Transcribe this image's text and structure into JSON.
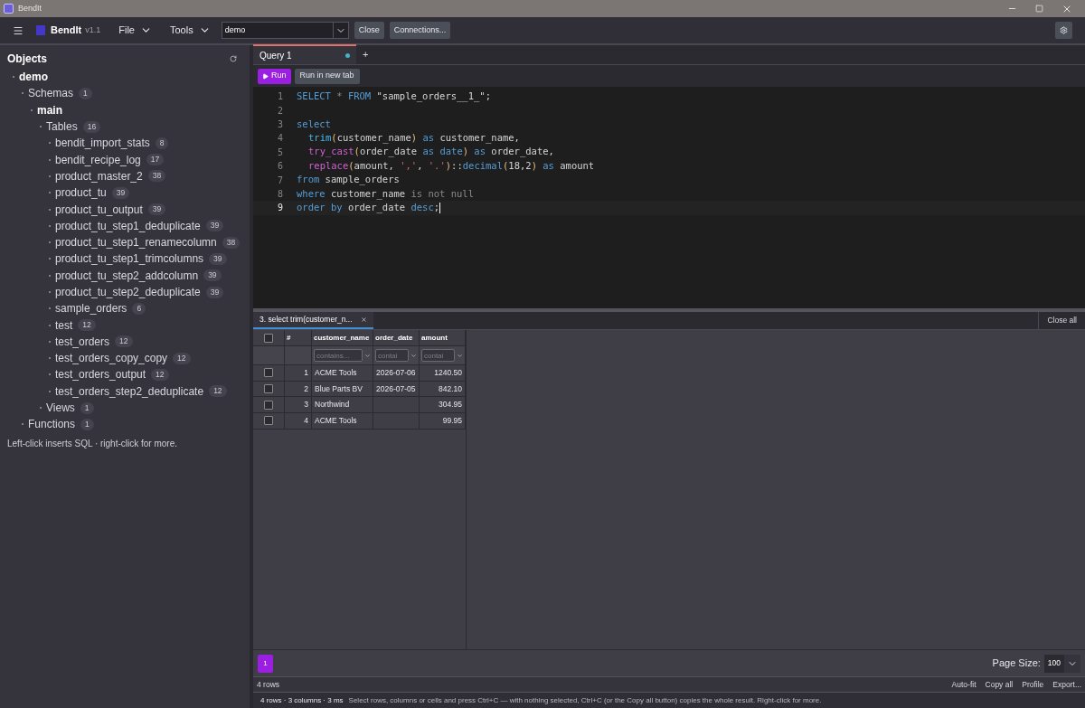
{
  "window": {
    "title": "BendIt"
  },
  "toolbar": {
    "app_name": "BendIt",
    "version": "v1.1",
    "menus": [
      {
        "label": "File"
      },
      {
        "label": "Tools"
      }
    ],
    "connection": {
      "value": "demo"
    },
    "buttons": [
      "Close",
      "Connections..."
    ]
  },
  "sidebar": {
    "title": "Objects",
    "tree": [
      {
        "label": "demo",
        "bold": true,
        "children": [
          {
            "label": "Schemas",
            "count": "1",
            "bold": false,
            "children": [
              {
                "label": "main",
                "bold": true,
                "children": [
                  {
                    "label": "Tables",
                    "count": "16",
                    "bold": false,
                    "children": [
                      {
                        "label": "bendit_import_stats",
                        "count": "8",
                        "bold": false
                      },
                      {
                        "label": "bendit_recipe_log",
                        "count": "17",
                        "bold": false
                      },
                      {
                        "label": "product_master_2",
                        "count": "38",
                        "bold": false
                      },
                      {
                        "label": "product_tu",
                        "count": "39",
                        "bold": false
                      },
                      {
                        "label": "product_tu_output",
                        "count": "39",
                        "bold": false
                      },
                      {
                        "label": "product_tu_step1_deduplicate",
                        "count": "39",
                        "bold": false
                      },
                      {
                        "label": "product_tu_step1_renamecolumn",
                        "count": "38",
                        "bold": false
                      },
                      {
                        "label": "product_tu_step1_trimcolumns",
                        "count": "39",
                        "bold": false
                      },
                      {
                        "label": "product_tu_step2_addcolumn",
                        "count": "39",
                        "bold": false
                      },
                      {
                        "label": "product_tu_step2_deduplicate",
                        "count": "39",
                        "bold": false
                      },
                      {
                        "label": "sample_orders",
                        "count": "6",
                        "bold": false
                      },
                      {
                        "label": "test",
                        "count": "12",
                        "bold": false
                      },
                      {
                        "label": "test_orders",
                        "count": "12",
                        "bold": false
                      },
                      {
                        "label": "test_orders_copy_copy",
                        "count": "12",
                        "bold": false
                      },
                      {
                        "label": "test_orders_output",
                        "count": "12",
                        "bold": false
                      },
                      {
                        "label": "test_orders_step2_deduplicate",
                        "count": "12",
                        "bold": false
                      }
                    ]
                  },
                  {
                    "label": "Views",
                    "count": "1",
                    "bold": false
                  }
                ]
              }
            ]
          },
          {
            "label": "Functions",
            "count": "1",
            "bold": false
          }
        ]
      }
    ],
    "hint": "Left-click inserts SQL · right-click for more."
  },
  "editor": {
    "tabs": [
      {
        "label": "Query 1",
        "selected": true,
        "modified": true
      }
    ],
    "new_tab": "+",
    "run": "Run",
    "run_new": "Run in new tab",
    "lines": [
      {
        "number": "1",
        "current": false,
        "tokens": [
          {
            "kind": "keyword",
            "text": "SELECT"
          },
          {
            "kind": "op",
            "text": " * "
          },
          {
            "kind": "keyword",
            "text": "FROM"
          },
          {
            "kind": "plain",
            "text": " \"sample_orders__1_\";"
          }
        ]
      },
      {
        "number": "2",
        "current": false
      },
      {
        "number": "3",
        "current": false,
        "tokens": [
          {
            "kind": "keyword",
            "text": "select"
          }
        ]
      },
      {
        "number": "4",
        "current": false,
        "indent": true,
        "tokens": [
          {
            "kind": "function",
            "text": "trim"
          },
          {
            "kind": "paren",
            "text": "("
          },
          {
            "kind": "plain",
            "text": "customer_name"
          },
          {
            "kind": "paren",
            "text": ")"
          },
          {
            "kind": "keyword",
            "text": " as"
          },
          {
            "kind": "plain",
            "text": " customer_name,"
          }
        ]
      },
      {
        "number": "5",
        "current": false,
        "indent": true,
        "tokens": [
          {
            "kind": "builtin",
            "text": "try_cast"
          },
          {
            "kind": "paren",
            "text": "("
          },
          {
            "kind": "plain",
            "text": "order_date "
          },
          {
            "kind": "keyword",
            "text": "as date"
          },
          {
            "kind": "paren",
            "text": ")"
          },
          {
            "kind": "keyword",
            "text": " as"
          },
          {
            "kind": "plain",
            "text": " order_date,"
          }
        ]
      },
      {
        "number": "6",
        "current": false,
        "indent": true,
        "tokens": [
          {
            "kind": "builtin",
            "text": "replace"
          },
          {
            "kind": "paren",
            "text": "("
          },
          {
            "kind": "plain",
            "text": "amount, "
          },
          {
            "kind": "string",
            "text": "','"
          },
          {
            "kind": "plain",
            "text": ", "
          },
          {
            "kind": "string",
            "text": "'.'"
          },
          {
            "kind": "paren",
            "text": ")"
          },
          {
            "kind": "plain",
            "text": "::"
          },
          {
            "kind": "keyword",
            "text": "decimal"
          },
          {
            "kind": "paren",
            "text": "("
          },
          {
            "kind": "plain",
            "text": "18,2"
          },
          {
            "kind": "paren",
            "text": ")"
          },
          {
            "kind": "keyword",
            "text": " as"
          },
          {
            "kind": "plain",
            "text": " amount"
          }
        ]
      },
      {
        "number": "7",
        "current": false,
        "tokens": [
          {
            "kind": "keyword",
            "text": "from"
          },
          {
            "kind": "plain",
            "text": " sample_orders"
          }
        ]
      },
      {
        "number": "8",
        "current": false,
        "tokens": [
          {
            "kind": "keyword",
            "text": "where"
          },
          {
            "kind": "plain",
            "text": " customer_name "
          },
          {
            "kind": "op",
            "text": "is not null"
          }
        ]
      },
      {
        "number": "9",
        "current": true,
        "tokens": [
          {
            "kind": "keyword",
            "text": "order by"
          },
          {
            "kind": "plain",
            "text": " order_date "
          },
          {
            "kind": "keyword",
            "text": "desc"
          },
          {
            "kind": "plain",
            "text": ";"
          }
        ]
      }
    ]
  },
  "results": {
    "select_all_checked": false,
    "tabs": [
      {
        "label": "3. select trim(customer_n...",
        "selected": true
      }
    ],
    "close_all": "Close all",
    "columns": [
      "#",
      "customer_name",
      "order_date",
      "amount"
    ],
    "filters": [
      {
        "placeholder": "contains..."
      },
      {
        "placeholder": "contai"
      },
      {
        "placeholder": "contai"
      }
    ],
    "rows": [
      {
        "checked": false,
        "cells": [
          "1",
          "ACME Tools",
          "2026-07-06",
          "1240.50"
        ]
      },
      {
        "checked": false,
        "cells": [
          "2",
          "Blue Parts BV",
          "2026-07-05",
          "842.10"
        ]
      },
      {
        "checked": false,
        "cells": [
          "3",
          "Northwind",
          "",
          "304.95"
        ]
      },
      {
        "checked": false,
        "cells": [
          "4",
          "ACME Tools",
          "",
          "99.95"
        ]
      }
    ],
    "pages": [
      {
        "label": "1",
        "selected": true
      }
    ],
    "page_size_label": "Page Size:",
    "page_size": "100",
    "row_count": "4 rows",
    "actions": [
      "Auto-fit",
      "Copy all",
      "Profile",
      "Export..."
    ]
  },
  "status_bar": {
    "summary": "4 rows · 3 columns · 3 ms",
    "message": "Select rows, columns or cells and press Ctrl+C — with nothing selected, Ctrl+C (or the Copy all button) copies the whole result. Right-click for more."
  }
}
